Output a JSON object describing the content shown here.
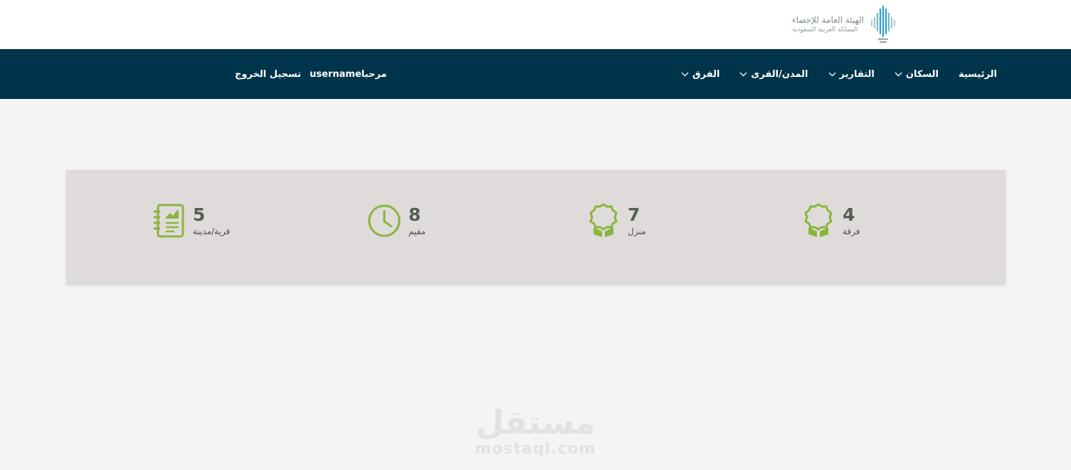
{
  "header": {
    "logo": {
      "line1": "الهيئة العامة للإحصاء",
      "line2": "المملكة العربية السعودية"
    }
  },
  "nav": {
    "items": [
      {
        "label": "الرئيسية",
        "has_dropdown": false
      },
      {
        "label": "السكان",
        "has_dropdown": true
      },
      {
        "label": "التقارير",
        "has_dropdown": true
      },
      {
        "label": "المدن/القرى",
        "has_dropdown": true
      },
      {
        "label": "الفرق",
        "has_dropdown": true
      }
    ],
    "welcome": "مرحبا",
    "username": "username",
    "logout": "تسجيل الخروج"
  },
  "stats": [
    {
      "value": "4",
      "label": "فرقة",
      "icon": "award-icon"
    },
    {
      "value": "7",
      "label": "منزل",
      "icon": "award-icon"
    },
    {
      "value": "8",
      "label": "مقيم",
      "icon": "clock-icon"
    },
    {
      "value": "5",
      "label": "قرية/مدينة",
      "icon": "notebook-chart-icon"
    }
  ],
  "watermark": {
    "arabic": "مستقل",
    "latin": "mostaql.com"
  },
  "colors": {
    "nav_bg": "#00344a",
    "accent_green": "#8ab53c",
    "stats_bg": "#e0dbdb",
    "page_bg": "#f4f4f4"
  }
}
